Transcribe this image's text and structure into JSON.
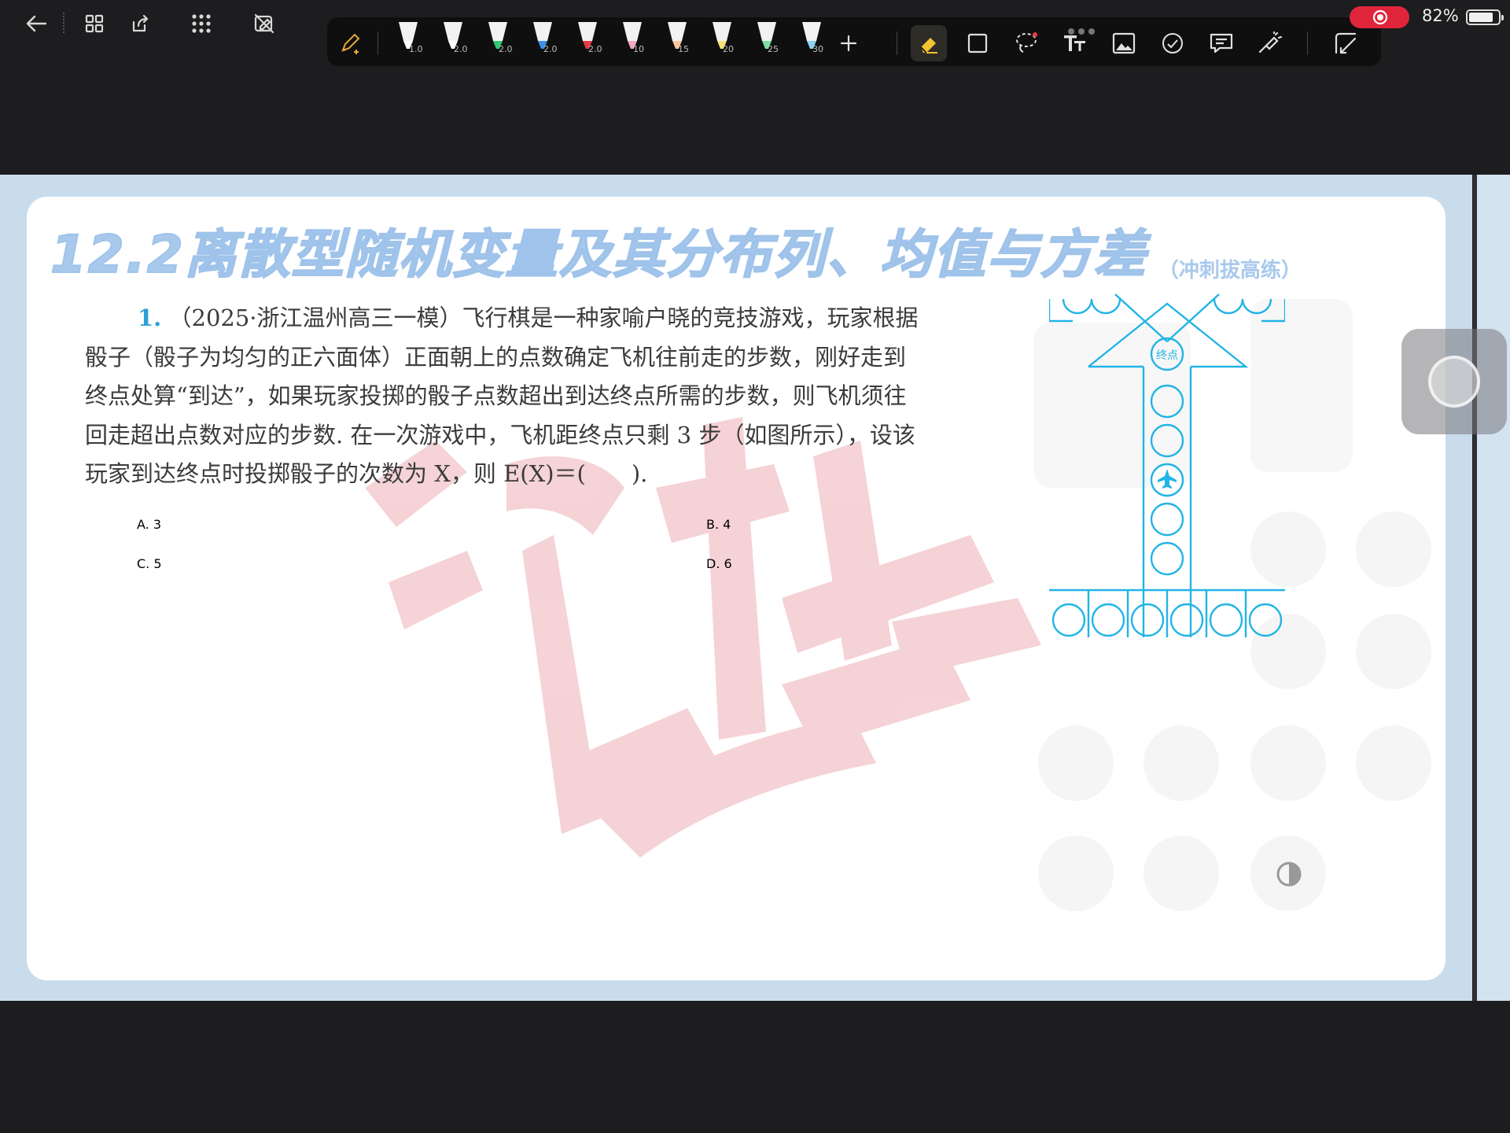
{
  "status": {
    "battery_percent": "82%",
    "battery_level": 0.82,
    "recording": true
  },
  "nav": {
    "icons": [
      "back-arrow-icon",
      "grid-thumbnails-icon",
      "export-icon",
      "apps-icon",
      "no-edit-icon"
    ]
  },
  "toolbar": {
    "pens": [
      {
        "size": "1.0",
        "color": "#ffffff"
      },
      {
        "size": "2.0",
        "color": "#ffffff"
      },
      {
        "size": "2.0",
        "color": "#2ecc71"
      },
      {
        "size": "2.0",
        "color": "#3a8fe8"
      },
      {
        "size": "2.0",
        "color": "#e63946"
      },
      {
        "size": "10",
        "color": "#f4a7c5"
      },
      {
        "size": "15",
        "color": "#f7c59f"
      },
      {
        "size": "20",
        "color": "#f7e27a"
      },
      {
        "size": "25",
        "color": "#7be0a0"
      },
      {
        "size": "30",
        "color": "#8ad4f0"
      }
    ],
    "tools": [
      "add-icon",
      "eraser-icon",
      "shape-icon",
      "lasso-icon",
      "text-icon",
      "image-icon",
      "sticker-icon",
      "comment-icon",
      "laser-pointer-icon",
      "crop-icon"
    ]
  },
  "page": {
    "heading": "12.2离散型随机变量及其分布列、均值与方差",
    "heading_sub": "（冲刺拔高练）",
    "question": {
      "number": "1.",
      "lines": [
        "（2025·浙江温州高三一模）飞行棋是一种家喻户晓的竞技游戏，玩家根据",
        "骰子（骰子为均匀的正六面体）正面朝上的点数确定飞机往前走的步数，刚好走到",
        "终点处算“到达”，如果玩家投掷的骰子点数超出到达终点所需的步数，则飞机须往",
        "回走超出点数对应的步数. 在一次游戏中，飞机距终点只剩 3 步（如图所示），设该",
        "玩家到达终点时投掷骰子的次数为 X，则 E(X)＝(　　)."
      ]
    },
    "options": {
      "a": "A.  3",
      "b": "B.  4",
      "c": "C.  5",
      "d": "D.  6"
    },
    "figure": {
      "end_label": "终点",
      "color": "#22b4e6"
    }
  }
}
